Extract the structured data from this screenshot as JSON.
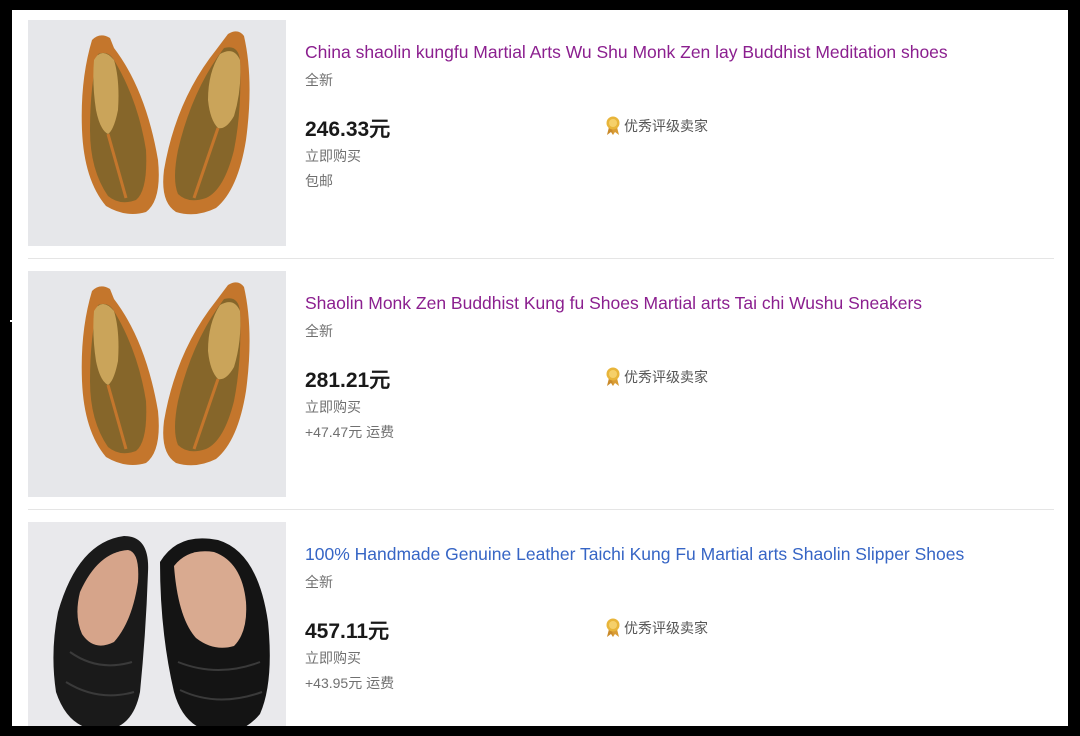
{
  "listings": [
    {
      "title": "China shaolin kungfu Martial Arts Wu Shu Monk Zen lay Buddhist Meditation shoes",
      "condition": "全新",
      "price": "246.33元",
      "buy_format": "立即购买",
      "shipping": "包邮",
      "seller_badge": "优秀评级卖家",
      "image": "brown-mesh-monk-shoes"
    },
    {
      "title": "Shaolin Monk Zen Buddhist Kung fu Shoes Martial arts Tai chi Wushu Sneakers",
      "condition": "全新",
      "price": "281.21元",
      "buy_format": "立即购买",
      "shipping": "+47.47元 运费",
      "seller_badge": "优秀评级卖家",
      "image": "brown-mesh-monk-shoes"
    },
    {
      "title": "100% Handmade Genuine Leather Taichi Kung Fu Martial arts Shaolin Slipper Shoes",
      "condition": "全新",
      "price": "457.11元",
      "buy_format": "立即购买",
      "shipping": "+43.95元 运费",
      "seller_badge": "优秀评级卖家",
      "image": "black-leather-kungfu-shoes"
    }
  ],
  "colors": {
    "visited_link": "#8b1f8f",
    "link": "#3665c5",
    "price": "#191919",
    "secondary_text": "#707070",
    "badge_gold": "#e8b53a"
  }
}
